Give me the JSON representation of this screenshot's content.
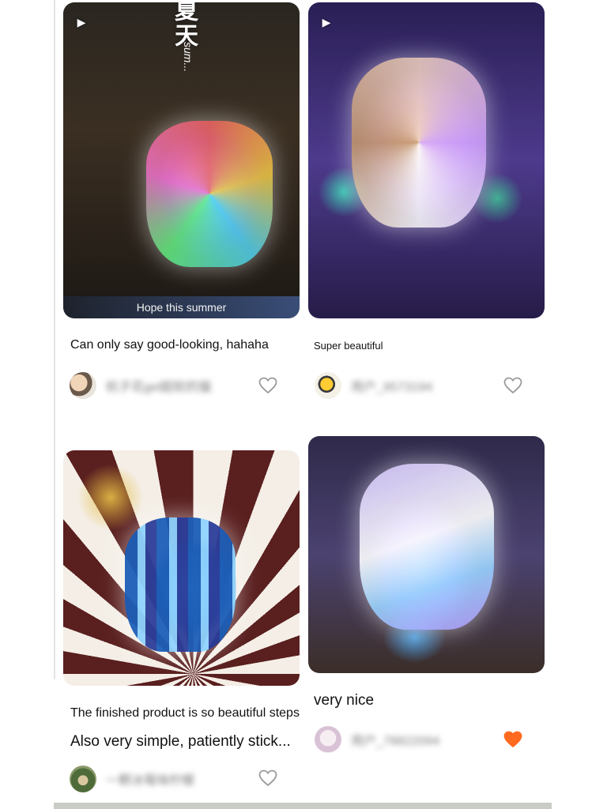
{
  "feed": {
    "cards": [
      {
        "overlay_text": "夏天",
        "overlay_sub": "sum...",
        "caption": "Hope this summer",
        "title": "Can only say good-looking, hahaha",
        "author": "杭子花gel超软的猫",
        "liked": false
      },
      {
        "title": "Super beautiful",
        "author": "用户_9573194",
        "liked": false
      },
      {
        "title_line1": "The finished product is so beautiful steps",
        "title_line2": "Also very simple, patiently stick...",
        "author": "一颗冰莓味柠檬",
        "liked": false
      },
      {
        "title": "very nice",
        "author": "用户_78822094",
        "liked": true
      }
    ]
  },
  "colors": {
    "heart_outline": "#9a9a9a",
    "heart_liked": "#ff6a1f"
  },
  "icons": {
    "video": "play-icon",
    "like": "heart-icon"
  }
}
